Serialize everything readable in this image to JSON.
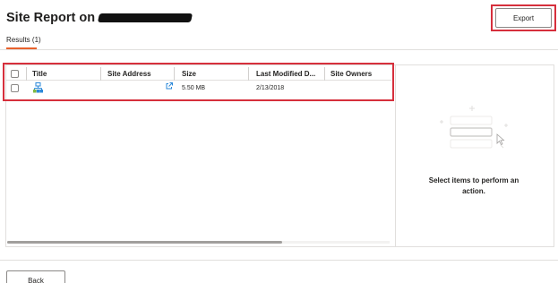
{
  "header": {
    "title": "Site Report on",
    "export_label": "Export"
  },
  "tabs": [
    {
      "label": "Results (1)",
      "active": true
    }
  ],
  "table": {
    "columns": [
      "Title",
      "Site Address",
      "Size",
      "Last Modified D...",
      "Site Owners"
    ],
    "rows": [
      {
        "title_icon": "site-icon",
        "site_address_icon": "external-link-icon",
        "size": "5.50 MB",
        "last_modified": "2/13/2018",
        "site_owners": ""
      }
    ]
  },
  "details_pane": {
    "message": "Select items to perform an action."
  },
  "footer": {
    "back_label": "Back"
  },
  "colors": {
    "accent": "#e8612c",
    "highlight": "#d62f3c",
    "link": "#0078d4"
  }
}
